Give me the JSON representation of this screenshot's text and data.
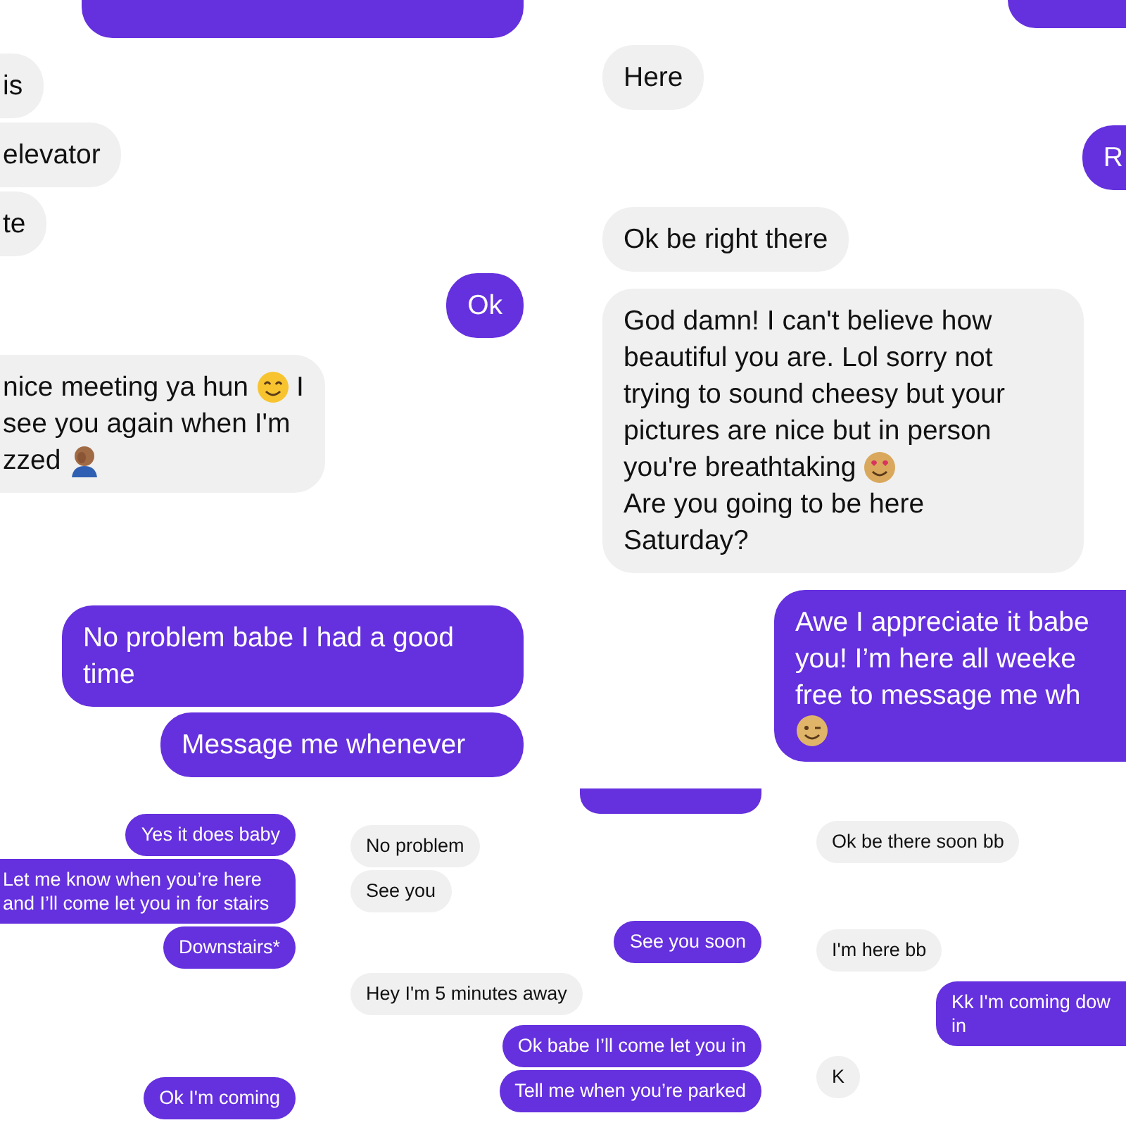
{
  "panels": [
    {
      "messages": [
        {
          "sent": true,
          "kind": "partial"
        },
        {
          "sent": false,
          "lines": [
            [
              "is"
            ]
          ]
        },
        {
          "sent": false,
          "lines": [
            [
              "elevator"
            ]
          ]
        },
        {
          "sent": false,
          "lines": [
            [
              "te"
            ]
          ]
        },
        {
          "sent": true,
          "lines": [
            [
              "Ok"
            ]
          ]
        },
        {
          "sent": false,
          "lines": [
            [
              "nice meeting ya hun",
              {
                "kind": "smile"
              },
              "I"
            ],
            [
              "see you again when I'm"
            ],
            [
              "zzed",
              {
                "kind": "facepalm"
              }
            ]
          ]
        },
        {
          "sent": true,
          "lines": [
            [
              "No problem babe I had a good"
            ],
            [
              "time"
            ]
          ]
        },
        {
          "sent": true,
          "lines": [
            [
              "Message me whenever"
            ]
          ]
        }
      ]
    },
    {
      "messages": [
        {
          "sent": true,
          "kind": "partial"
        },
        {
          "sent": false,
          "lines": [
            [
              "Here"
            ]
          ]
        },
        {
          "sent": true,
          "lines": [
            [
              "R"
            ]
          ]
        },
        {
          "sent": false,
          "lines": [
            [
              "Ok be right there"
            ]
          ]
        },
        {
          "sent": false,
          "lines": [
            [
              "God damn! I can't believe how"
            ],
            [
              "beautiful you are. Lol sorry not"
            ],
            [
              "trying to sound cheesy but your"
            ],
            [
              "pictures are nice but in person"
            ],
            [
              "you're breathtaking",
              {
                "kind": "heart-eyes"
              }
            ],
            [
              "Are you going to be here"
            ],
            [
              "Saturday?"
            ]
          ]
        },
        {
          "sent": true,
          "lines": [
            [
              "Awe I appreciate it babe"
            ],
            [
              "you! I’m here all weeke"
            ],
            [
              "free to message me wh"
            ],
            [
              {
                "kind": "wink"
              }
            ]
          ]
        }
      ]
    },
    {
      "messages": [
        {
          "sent": true,
          "lines": [
            [
              "Yes it does baby"
            ]
          ]
        },
        {
          "sent": true,
          "lines": [
            [
              "Let me know when you’re here"
            ],
            [
              "and I’ll come let you in for stairs"
            ]
          ]
        },
        {
          "sent": true,
          "lines": [
            [
              "Downstairs*"
            ]
          ]
        },
        {
          "sent": true,
          "lines": [
            [
              "Ok I'm coming"
            ]
          ]
        }
      ]
    },
    {
      "messages": [
        {
          "sent": true,
          "kind": "partial"
        },
        {
          "sent": false,
          "lines": [
            [
              "No problem"
            ]
          ]
        },
        {
          "sent": false,
          "lines": [
            [
              "See you"
            ]
          ]
        },
        {
          "sent": true,
          "lines": [
            [
              "See you soon"
            ]
          ]
        },
        {
          "sent": false,
          "lines": [
            [
              "Hey I'm 5 minutes away"
            ]
          ]
        },
        {
          "sent": true,
          "lines": [
            [
              "Ok babe I’ll come let you in"
            ]
          ]
        },
        {
          "sent": true,
          "lines": [
            [
              "Tell me when you’re parked"
            ]
          ]
        }
      ]
    },
    {
      "messages": [
        {
          "sent": false,
          "lines": [
            [
              "Ok be there soon bb"
            ]
          ]
        },
        {
          "sent": false,
          "lines": [
            [
              "I'm here bb"
            ]
          ]
        },
        {
          "sent": true,
          "lines": [
            [
              "Kk I'm coming dow"
            ],
            [
              "in"
            ]
          ]
        },
        {
          "sent": false,
          "lines": [
            [
              "K"
            ]
          ]
        }
      ]
    }
  ]
}
